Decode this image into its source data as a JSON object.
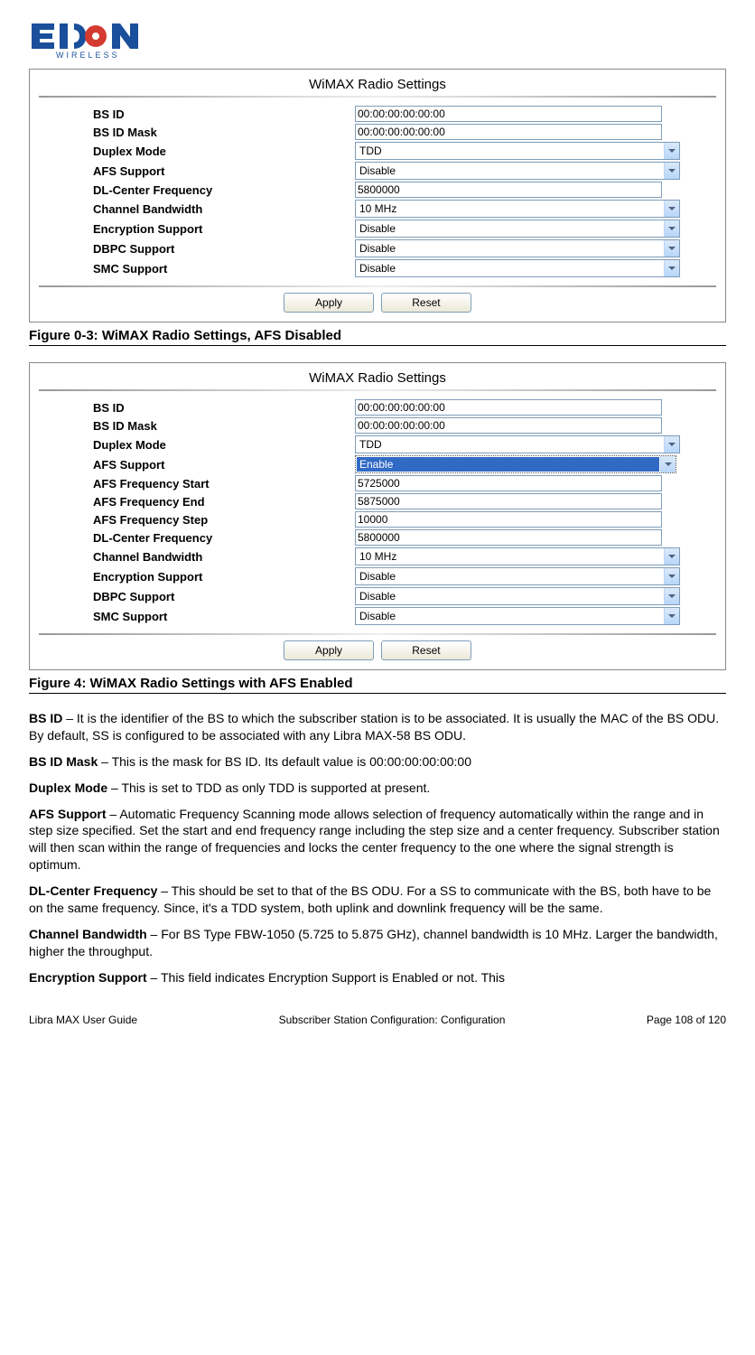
{
  "logo": {
    "brand": "EION",
    "sub": "WIRELESS"
  },
  "panel1": {
    "title": "WiMAX Radio Settings",
    "rows": [
      {
        "label": "BS ID",
        "type": "text",
        "value": "00:00:00:00:00:00"
      },
      {
        "label": "BS ID Mask",
        "type": "text",
        "value": "00:00:00:00:00:00"
      },
      {
        "label": "Duplex Mode",
        "type": "select",
        "value": "TDD"
      },
      {
        "label": "AFS Support",
        "type": "select",
        "value": "Disable"
      },
      {
        "label": "DL-Center Frequency",
        "type": "text",
        "value": "5800000"
      },
      {
        "label": "Channel Bandwidth",
        "type": "select",
        "value": "10 MHz"
      },
      {
        "label": "Encryption Support",
        "type": "select",
        "value": "Disable"
      },
      {
        "label": "DBPC Support",
        "type": "select",
        "value": "Disable"
      },
      {
        "label": "SMC Support",
        "type": "select",
        "value": "Disable"
      }
    ],
    "apply": "Apply",
    "reset": "Reset"
  },
  "caption1": "Figure 0-3: WiMAX Radio Settings, AFS Disabled",
  "panel2": {
    "title": "WiMAX Radio Settings",
    "rows": [
      {
        "label": "BS ID",
        "type": "text",
        "value": "00:00:00:00:00:00"
      },
      {
        "label": "BS ID Mask",
        "type": "text",
        "value": "00:00:00:00:00:00"
      },
      {
        "label": "Duplex Mode",
        "type": "select",
        "value": "TDD"
      },
      {
        "label": "AFS Support",
        "type": "select-hl",
        "value": "Enable"
      },
      {
        "label": "AFS Frequency Start",
        "type": "text",
        "value": "5725000"
      },
      {
        "label": "AFS Frequency End",
        "type": "text",
        "value": "5875000"
      },
      {
        "label": "AFS Frequency Step",
        "type": "text",
        "value": "10000"
      },
      {
        "label": "DL-Center Frequency",
        "type": "text",
        "value": "5800000"
      },
      {
        "label": "Channel Bandwidth",
        "type": "select",
        "value": "10 MHz"
      },
      {
        "label": "Encryption Support",
        "type": "select",
        "value": "Disable"
      },
      {
        "label": "DBPC Support",
        "type": "select",
        "value": "Disable"
      },
      {
        "label": "SMC Support",
        "type": "select",
        "value": "Disable"
      }
    ],
    "apply": "Apply",
    "reset": "Reset"
  },
  "caption2": "Figure 4: WiMAX Radio Settings with AFS Enabled",
  "desc": {
    "p1_b": "BS ID",
    "p1": " – It is the identifier of the BS to which the subscriber station is to be associated. It is usually the MAC of the BS ODU. By default, SS is configured to be associated with any Libra MAX-58 BS ODU.",
    "p2_b": "BS ID Mask",
    "p2": " – This is the mask for BS ID. Its default value is 00:00:00:00:00:00",
    "p3_b": "Duplex Mode",
    "p3": " – This is set to TDD as only TDD is supported at present.",
    "p4_b": "AFS Support",
    "p4": " – Automatic Frequency Scanning mode allows selection of frequency automatically within the range and in step size specified. Set the start and end frequency range including the step size and a center frequency. Subscriber station will then scan within the range of frequencies and locks the center frequency to the one where the signal strength is optimum.",
    "p5_b": "DL-Center Frequency",
    "p5": " – This should be set to that of the BS ODU. For a SS to communicate with the BS, both have to be on the same frequency.  Since, it's a TDD system, both uplink and downlink frequency will be the same.",
    "p6_b": "Channel Bandwidth",
    "p6": " – For BS Type FBW-1050 (5.725 to 5.875 GHz), channel bandwidth is 10 MHz. Larger the bandwidth, higher the throughput.",
    "p7_b": "Encryption Support",
    "p7": " – This field indicates Encryption Support is Enabled or not. This"
  },
  "footer": {
    "left": "Libra MAX User Guide",
    "center": "Subscriber Station Configuration: Configuration",
    "right": "Page 108 of 120"
  }
}
